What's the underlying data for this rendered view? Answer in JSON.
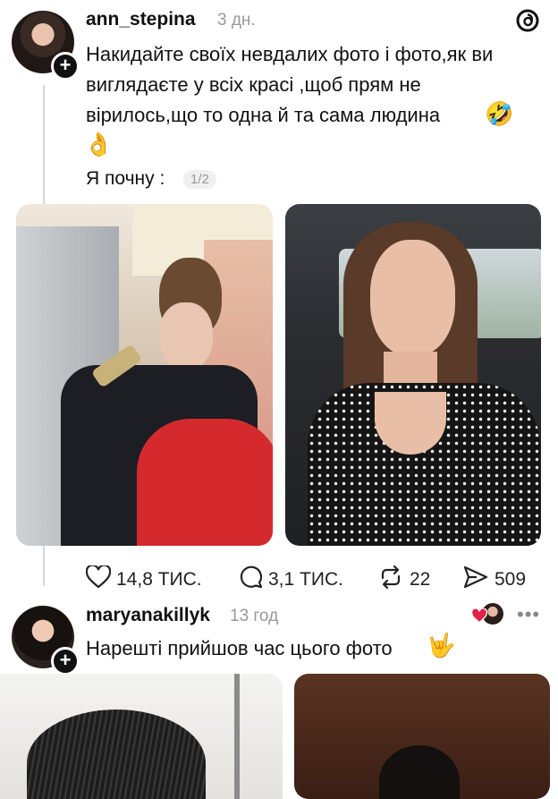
{
  "post1": {
    "username": "ann_stepina",
    "time": "3 дн.",
    "text": "Накидайте своїх невдалих фото і фото,як ви\nвиглядаєте у всіх красі ,щоб прям не\nвірилось,що то одна й та сама людина",
    "emoji_laugh": "🤣",
    "emoji_hand": "👌",
    "sub_text": "Я почну :",
    "page_badge": "1/2",
    "likes": "14,8 ТИС.",
    "comments": "3,1 ТИС.",
    "reposts": "22",
    "shares": "509"
  },
  "post2": {
    "username": "maryanakillyk",
    "time": "13 год",
    "text": "Нарешті прийшов час цього фото",
    "emoji": "🤟"
  },
  "icons": {
    "threads_logo": "threads-logo",
    "like": "heart-icon",
    "comment": "comment-icon",
    "repost": "repost-icon",
    "share": "send-icon",
    "more": "more-dots-icon"
  }
}
